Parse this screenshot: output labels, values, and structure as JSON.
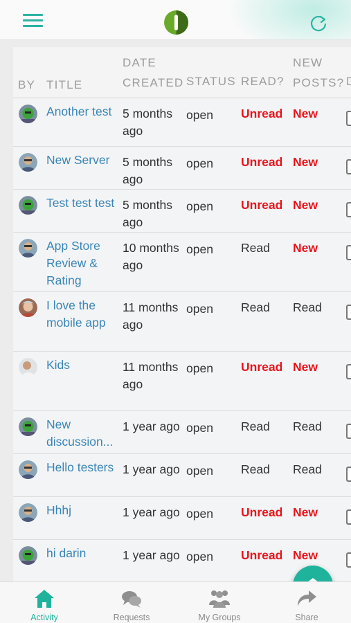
{
  "header": {
    "colors": {
      "accent": "#2bb3a3",
      "logo_green": "#6aaa2a",
      "logo_dark": "#3d6b17"
    }
  },
  "table": {
    "columns": {
      "by": "BY",
      "title": "TITLE",
      "date_created": "DATE CREATED",
      "status": "STATUS",
      "read": "READ?",
      "new_posts": "NEW POSTS?",
      "extra": "D"
    },
    "rows": [
      {
        "avatar": "robot-avatar",
        "title": "Another test",
        "date": "5 months ago",
        "status": "open",
        "read": "Unread",
        "new_posts": "New"
      },
      {
        "avatar": "person-avatar",
        "title": "New Server",
        "date": "5 months ago",
        "status": "open",
        "read": "Unread",
        "new_posts": "New"
      },
      {
        "avatar": "robot-avatar",
        "title": "Test test test",
        "date": "5 months ago",
        "status": "open",
        "read": "Unread",
        "new_posts": "New"
      },
      {
        "avatar": "person-avatar",
        "title": "App Store Review & Rating",
        "date": "10 months ago",
        "status": "open",
        "read": "Read",
        "new_posts": "New"
      },
      {
        "avatar": "person-avatar-2",
        "title": "I love the mobile app",
        "date": "11 months ago",
        "status": "open",
        "read": "Read",
        "new_posts": "Read"
      },
      {
        "avatar": "person-avatar-3",
        "title": "Kids",
        "date": "11 months ago",
        "status": "open",
        "read": "Unread",
        "new_posts": "New"
      },
      {
        "avatar": "robot-avatar",
        "title": "New discussion...",
        "date": "1 year ago",
        "status": "open",
        "read": "Read",
        "new_posts": "Read"
      },
      {
        "avatar": "person-avatar",
        "title": "Hello testers",
        "date": "1 year ago",
        "status": "open",
        "read": "Read",
        "new_posts": "Read"
      },
      {
        "avatar": "person-avatar",
        "title": "Hhhj",
        "date": "1 year ago",
        "status": "open",
        "read": "Unread",
        "new_posts": "New"
      },
      {
        "avatar": "robot-avatar",
        "title": "hi darin",
        "date": "1 year ago",
        "status": "open",
        "read": "Unread",
        "new_posts": "New"
      }
    ],
    "colors": {
      "link": "#3a86b5",
      "unread": "#e8141b"
    }
  },
  "fab": {
    "icon": "envelope-open-icon",
    "color": "#1fb39c"
  },
  "bottom_nav": {
    "items": [
      {
        "label": "Activity",
        "icon": "home-icon",
        "active": true
      },
      {
        "label": "Requests",
        "icon": "chat-bubbles-icon",
        "active": false
      },
      {
        "label": "My Groups",
        "icon": "group-icon",
        "active": false
      },
      {
        "label": "Share",
        "icon": "share-arrow-icon",
        "active": false
      }
    ]
  }
}
